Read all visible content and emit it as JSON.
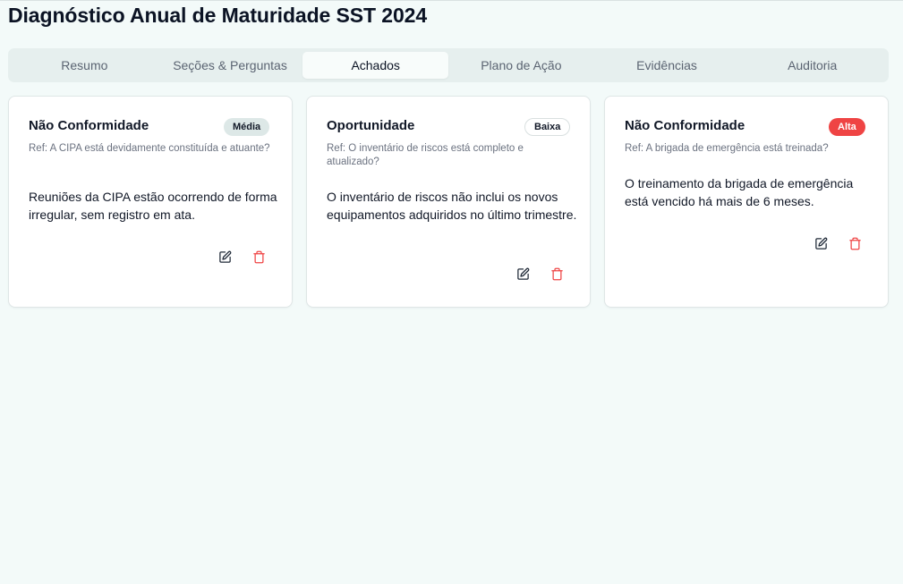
{
  "page": {
    "title": "Diagnóstico Anual de Maturidade SST 2024"
  },
  "tabs": [
    {
      "label": "Resumo",
      "active": false
    },
    {
      "label": "Seções & Perguntas",
      "active": false
    },
    {
      "label": "Achados",
      "active": true
    },
    {
      "label": "Plano de Ação",
      "active": false
    },
    {
      "label": "Evidências",
      "active": false
    },
    {
      "label": "Auditoria",
      "active": false
    }
  ],
  "findings": [
    {
      "type": "Não Conformidade",
      "severity": "Média",
      "severity_level": "media",
      "ref": "Ref: A CIPA está devidamente constituída e atuante?",
      "description": "Reuniões da CIPA estão ocorrendo de forma irregular, sem registro em ata."
    },
    {
      "type": "Oportunidade",
      "severity": "Baixa",
      "severity_level": "baixa",
      "ref": "Ref: O inventário de riscos está completo e atualizado?",
      "description": "O inventário de riscos não inclui os novos equipamentos adquiridos no último trimestre."
    },
    {
      "type": "Não Conformidade",
      "severity": "Alta",
      "severity_level": "alta",
      "ref": "Ref: A brigada de emergência está treinada?",
      "description": "O treinamento da brigada de emergência está vencido há mais de 6 meses."
    }
  ],
  "icons": {
    "edit": "edit-icon",
    "delete": "trash-icon"
  },
  "colors": {
    "background": "#f3faf9",
    "accent_danger": "#ef4444",
    "badge_media": "#dde8e7"
  }
}
